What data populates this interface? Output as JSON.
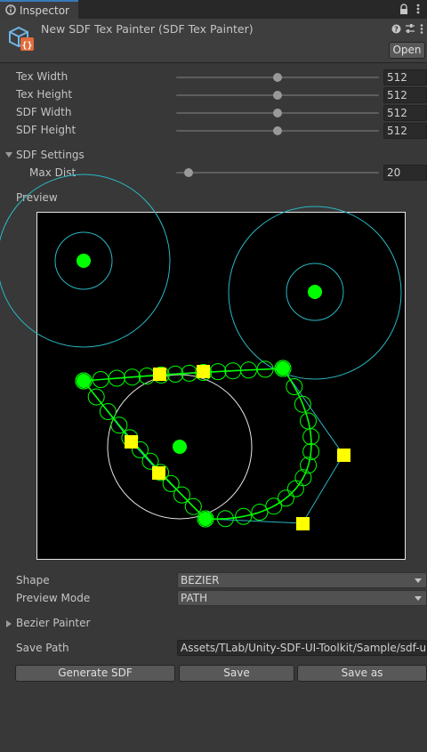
{
  "tab": {
    "label": "Inspector",
    "icon": "inspector-icon"
  },
  "toolbar_icons": [
    "lock-icon",
    "more-vert-icon"
  ],
  "header": {
    "title": "New SDF Tex Painter (SDF Tex Painter)",
    "icon": "scriptable-object-icon",
    "open_label": "Open",
    "header_icons": [
      "help-icon",
      "preset-icon",
      "more-vert-icon"
    ]
  },
  "fields": [
    {
      "label": "Tex Width",
      "value": "512",
      "ratio": 0.5
    },
    {
      "label": "Tex Height",
      "value": "512",
      "ratio": 0.5
    },
    {
      "label": "SDF Width",
      "value": "512",
      "ratio": 0.5
    },
    {
      "label": "SDF Height",
      "value": "512",
      "ratio": 0.5
    }
  ],
  "sdf_settings": {
    "label": "SDF Settings",
    "max_dist": {
      "label": "Max Dist",
      "value": "20",
      "ratio": 0.04
    }
  },
  "preview": {
    "label": "Preview"
  },
  "shape": {
    "label": "Shape",
    "value": "BEZIER"
  },
  "preview_mode": {
    "label": "Preview Mode",
    "value": "PATH"
  },
  "bezier_painter": {
    "label": "Bezier Painter"
  },
  "save_path": {
    "label": "Save Path",
    "value": "Assets/TLab/Unity-SDF-UI-Toolkit/Sample/sdf-ui"
  },
  "buttons": {
    "generate": "Generate SDF",
    "save": "Save",
    "save_as": "Save as"
  },
  "colors": {
    "point": "#00ff00",
    "control_point": "#ffff00",
    "radius_ring": "#2ab7c3",
    "circle_outline": "#e6e6e6"
  }
}
